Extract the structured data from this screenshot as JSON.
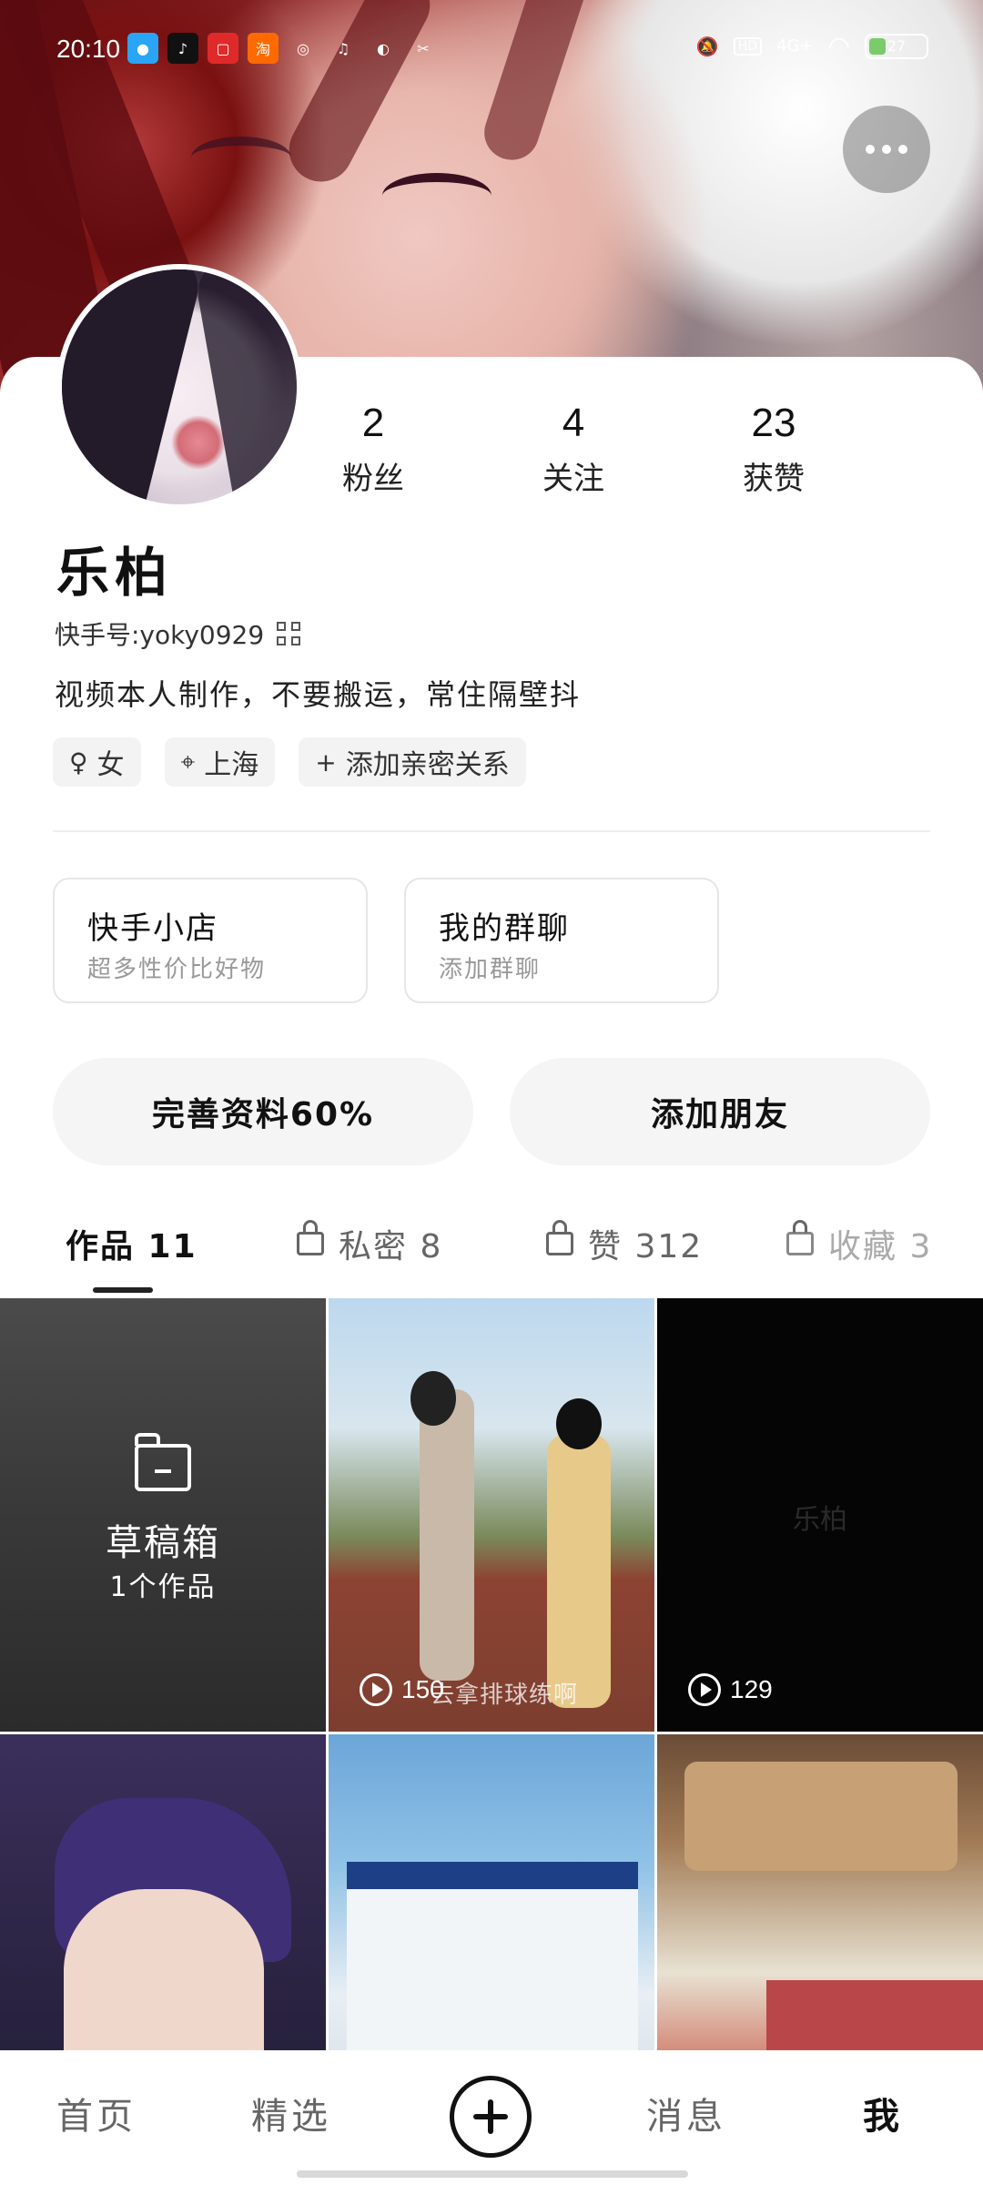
{
  "status_bar": {
    "time": "20:10",
    "battery": "27",
    "network": "4G+",
    "hd": "HD"
  },
  "stats": [
    {
      "value": "2",
      "label": "粉丝"
    },
    {
      "value": "4",
      "label": "关注"
    },
    {
      "value": "23",
      "label": "获赞"
    }
  ],
  "profile": {
    "name": "乐柏",
    "kuaishou_id": "快手号:yoky0929",
    "bio": "视频本人制作，不要搬运，常住隔壁抖",
    "tags": [
      "女",
      "上海",
      "添加亲密关系"
    ]
  },
  "services": [
    {
      "title": "快手小店",
      "subtitle": "超多性价比好物"
    },
    {
      "title": "我的群聊",
      "subtitle": "添加群聊"
    }
  ],
  "actions": {
    "complete_profile": "完善资料60%",
    "add_friend": "添加朋友"
  },
  "tabs": [
    {
      "label": "作品 11",
      "active": true
    },
    {
      "label": "私密 8",
      "locked": true
    },
    {
      "label": "赞 312",
      "locked": true
    },
    {
      "label": "收藏 3",
      "locked": true
    }
  ],
  "grid": {
    "draft_title": "草稿箱",
    "draft_count": "1个作品",
    "plays": [
      "150",
      "129"
    ],
    "video1_caption": "去拿排球练啊",
    "video2_watermark": "乐柏"
  },
  "bottom_nav": {
    "home": "首页",
    "featured": "精选",
    "messages": "消息",
    "me": "我"
  }
}
